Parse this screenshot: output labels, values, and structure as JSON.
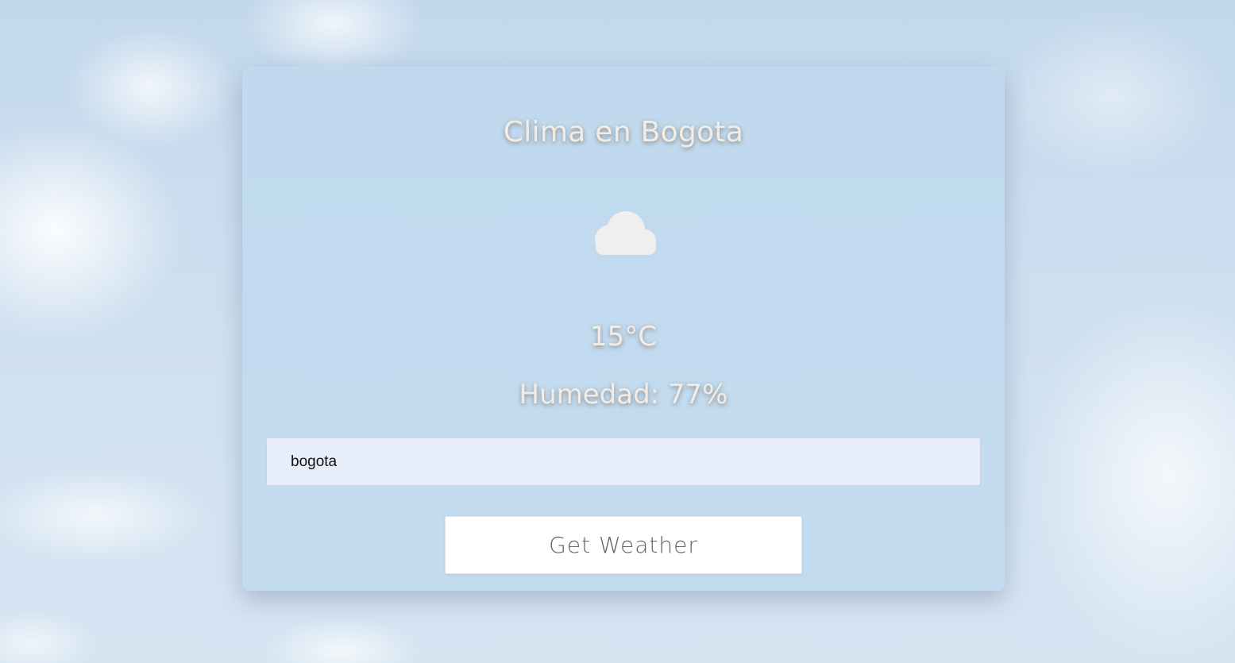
{
  "header": {
    "title": "Clima en Bogota"
  },
  "weather": {
    "icon": "cloud-icon",
    "temperature": "15°C",
    "humidity": "Humedad: 77%"
  },
  "search": {
    "value": "bogota",
    "placeholder": ""
  },
  "actions": {
    "get_weather_label": "Get Weather"
  },
  "colors": {
    "text": "#f1ede6",
    "input_bg": "#e8effb",
    "button_bg": "#ffffff",
    "button_text": "#6b625c"
  }
}
